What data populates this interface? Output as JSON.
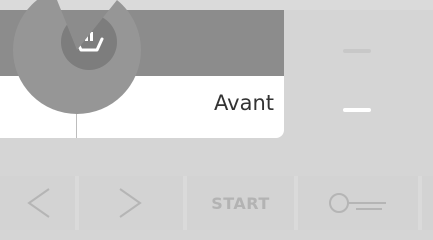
{
  "program": {
    "mode_label": "Avant"
  },
  "dial": {
    "icon": "pause-basin-icon"
  },
  "options": {
    "levels_total": 2,
    "level_active": 2
  },
  "controls": {
    "prev_icon": "chevron-left-icon",
    "next_icon": "chevron-right-icon",
    "start_label": "START",
    "key_icon": "key-lock-icon"
  }
}
